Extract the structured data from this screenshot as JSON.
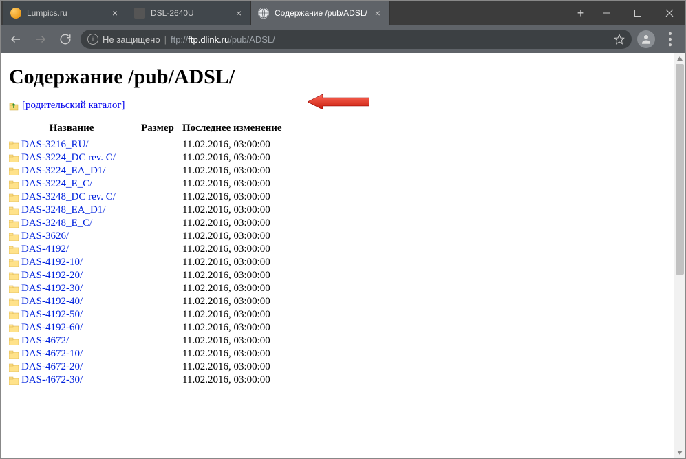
{
  "tabs": [
    {
      "title": "Lumpics.ru",
      "active": false,
      "favicon": "lumpics"
    },
    {
      "title": "DSL-2640U",
      "active": false,
      "favicon": "dsl"
    },
    {
      "title": "Содержание /pub/ADSL/",
      "active": true,
      "favicon": "globe"
    }
  ],
  "omnibox": {
    "security_label": "Не защищено",
    "url_scheme": "ftp://",
    "url_host": "ftp.dlink.ru",
    "url_path": "/pub/ADSL/"
  },
  "page": {
    "heading": "Содержание /pub/ADSL/",
    "parent_link": "[родительский каталог]",
    "columns": {
      "name": "Название",
      "size": "Размер",
      "modified": "Последнее изменение"
    }
  },
  "listing": [
    {
      "name": "DAS-3216_RU/",
      "size": "",
      "modified": "11.02.2016, 03:00:00"
    },
    {
      "name": "DAS-3224_DC rev. C/",
      "size": "",
      "modified": "11.02.2016, 03:00:00"
    },
    {
      "name": "DAS-3224_EA_D1/",
      "size": "",
      "modified": "11.02.2016, 03:00:00"
    },
    {
      "name": "DAS-3224_E_C/",
      "size": "",
      "modified": "11.02.2016, 03:00:00"
    },
    {
      "name": "DAS-3248_DC rev. C/",
      "size": "",
      "modified": "11.02.2016, 03:00:00"
    },
    {
      "name": "DAS-3248_EA_D1/",
      "size": "",
      "modified": "11.02.2016, 03:00:00"
    },
    {
      "name": "DAS-3248_E_C/",
      "size": "",
      "modified": "11.02.2016, 03:00:00"
    },
    {
      "name": "DAS-3626/",
      "size": "",
      "modified": "11.02.2016, 03:00:00"
    },
    {
      "name": "DAS-4192/",
      "size": "",
      "modified": "11.02.2016, 03:00:00"
    },
    {
      "name": "DAS-4192-10/",
      "size": "",
      "modified": "11.02.2016, 03:00:00"
    },
    {
      "name": "DAS-4192-20/",
      "size": "",
      "modified": "11.02.2016, 03:00:00"
    },
    {
      "name": "DAS-4192-30/",
      "size": "",
      "modified": "11.02.2016, 03:00:00"
    },
    {
      "name": "DAS-4192-40/",
      "size": "",
      "modified": "11.02.2016, 03:00:00"
    },
    {
      "name": "DAS-4192-50/",
      "size": "",
      "modified": "11.02.2016, 03:00:00"
    },
    {
      "name": "DAS-4192-60/",
      "size": "",
      "modified": "11.02.2016, 03:00:00"
    },
    {
      "name": "DAS-4672/",
      "size": "",
      "modified": "11.02.2016, 03:00:00"
    },
    {
      "name": "DAS-4672-10/",
      "size": "",
      "modified": "11.02.2016, 03:00:00"
    },
    {
      "name": "DAS-4672-20/",
      "size": "",
      "modified": "11.02.2016, 03:00:00"
    },
    {
      "name": "DAS-4672-30/",
      "size": "",
      "modified": "11.02.2016, 03:00:00"
    }
  ]
}
